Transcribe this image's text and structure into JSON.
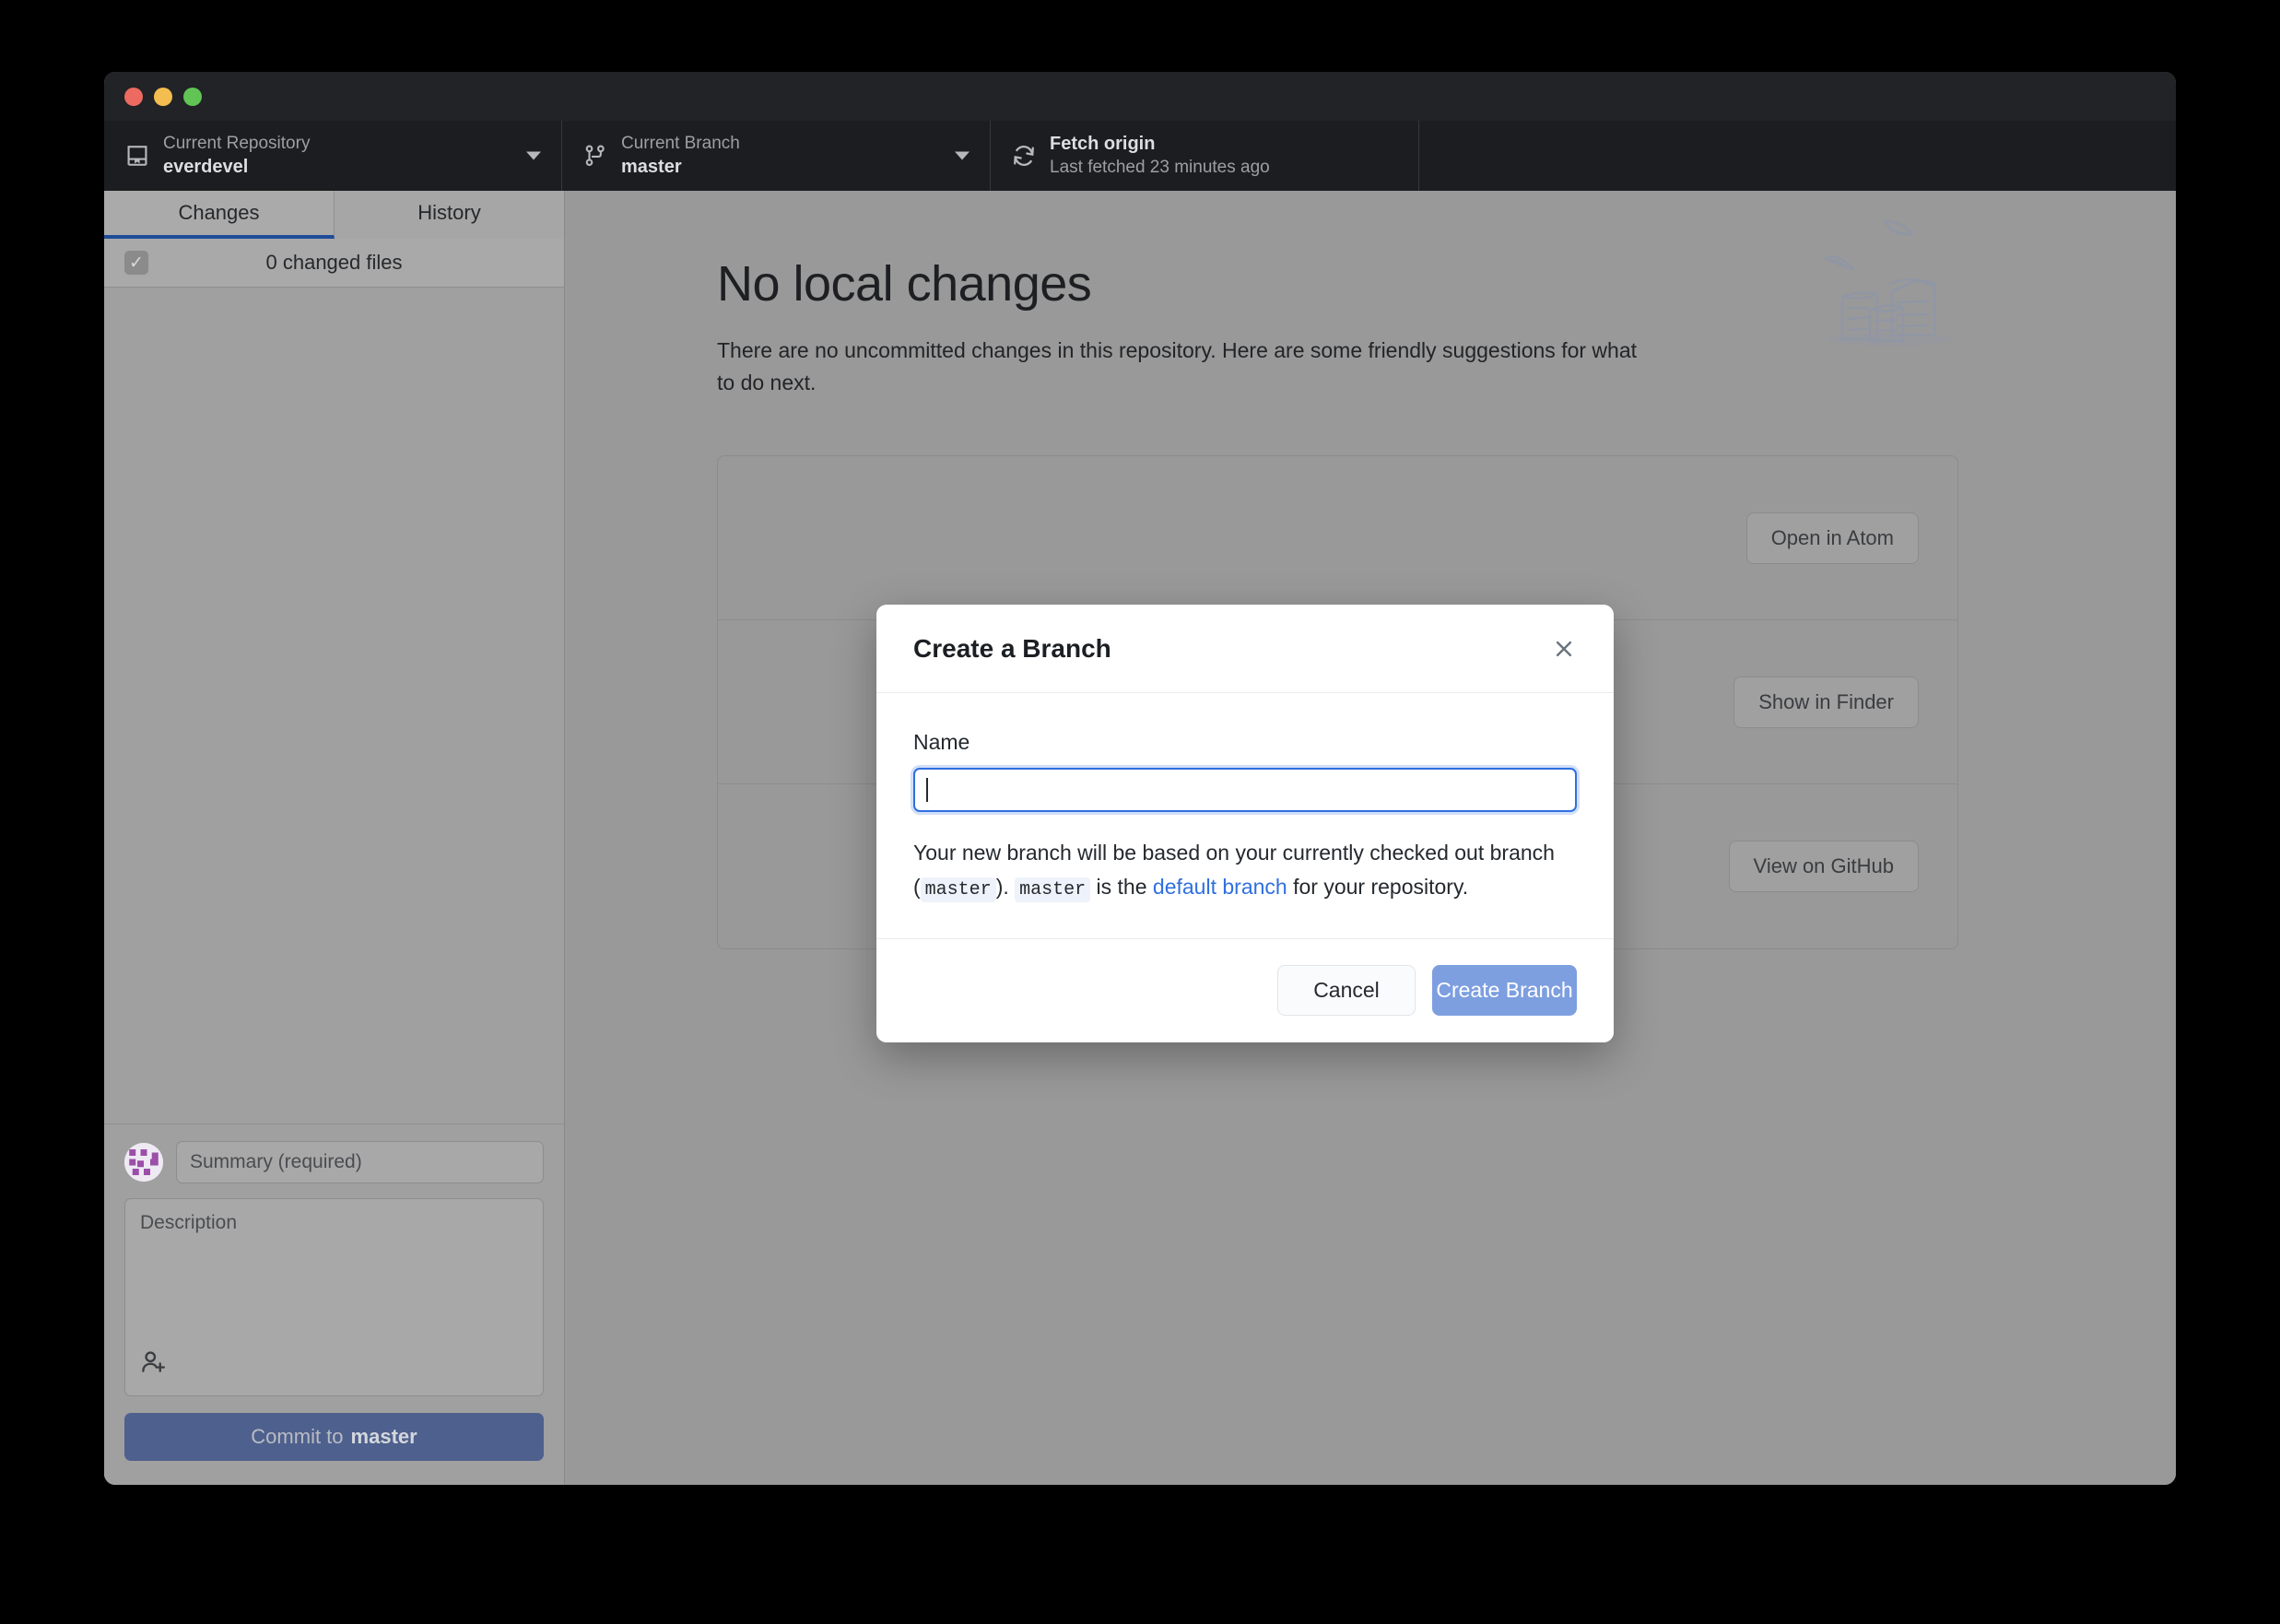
{
  "window": {
    "traffic_lights": [
      {
        "name": "close",
        "color": "#ec6a5f"
      },
      {
        "name": "minimize",
        "color": "#f4bd4f"
      },
      {
        "name": "zoom",
        "color": "#61c454"
      }
    ]
  },
  "toolbar": {
    "repository": {
      "label": "Current Repository",
      "value": "everdevel",
      "icon": "repo-icon"
    },
    "branch": {
      "label": "Current Branch",
      "value": "master",
      "icon": "git-branch-icon"
    },
    "fetch": {
      "title": "Fetch origin",
      "subtitle": "Last fetched 23 minutes ago",
      "icon": "sync-icon"
    }
  },
  "sidebar": {
    "tabs": [
      {
        "label": "Changes",
        "active": true
      },
      {
        "label": "History",
        "active": false
      }
    ],
    "changed_files_text": "0 changed files",
    "checkbox_state": "checked",
    "commit": {
      "summary_placeholder": "Summary (required)",
      "description_placeholder": "Description",
      "coauthor_icon": "add-co-author-icon",
      "button_prefix": "Commit to",
      "button_branch": "master"
    }
  },
  "main": {
    "title": "No local changes",
    "subtitle": "There are no uncommitted changes in this repository. Here are some friendly suggestions for what to do next.",
    "suggestions": [
      {
        "action_label": "Open in Atom"
      },
      {
        "action_label": "Show in Finder"
      },
      {
        "action_label": "View on GitHub"
      }
    ]
  },
  "modal": {
    "title": "Create a Branch",
    "close_icon": "close-icon",
    "name_label": "Name",
    "name_value": "",
    "help": {
      "part1": "Your new branch will be based on your currently checked out branch (",
      "code1": "master",
      "part2": "). ",
      "code2": "master",
      "part3": " is the ",
      "link": "default branch",
      "part4": " for your repository."
    },
    "cancel_label": "Cancel",
    "create_label": "Create Branch"
  },
  "colors": {
    "toolbar_bg": "#1b1d21",
    "titlebar_bg": "#212326",
    "accent_blue": "#2f6fe0",
    "primary_button": "#7d9fe0",
    "commit_button": "#4e608d",
    "tab_underline": "#1f4b99"
  }
}
